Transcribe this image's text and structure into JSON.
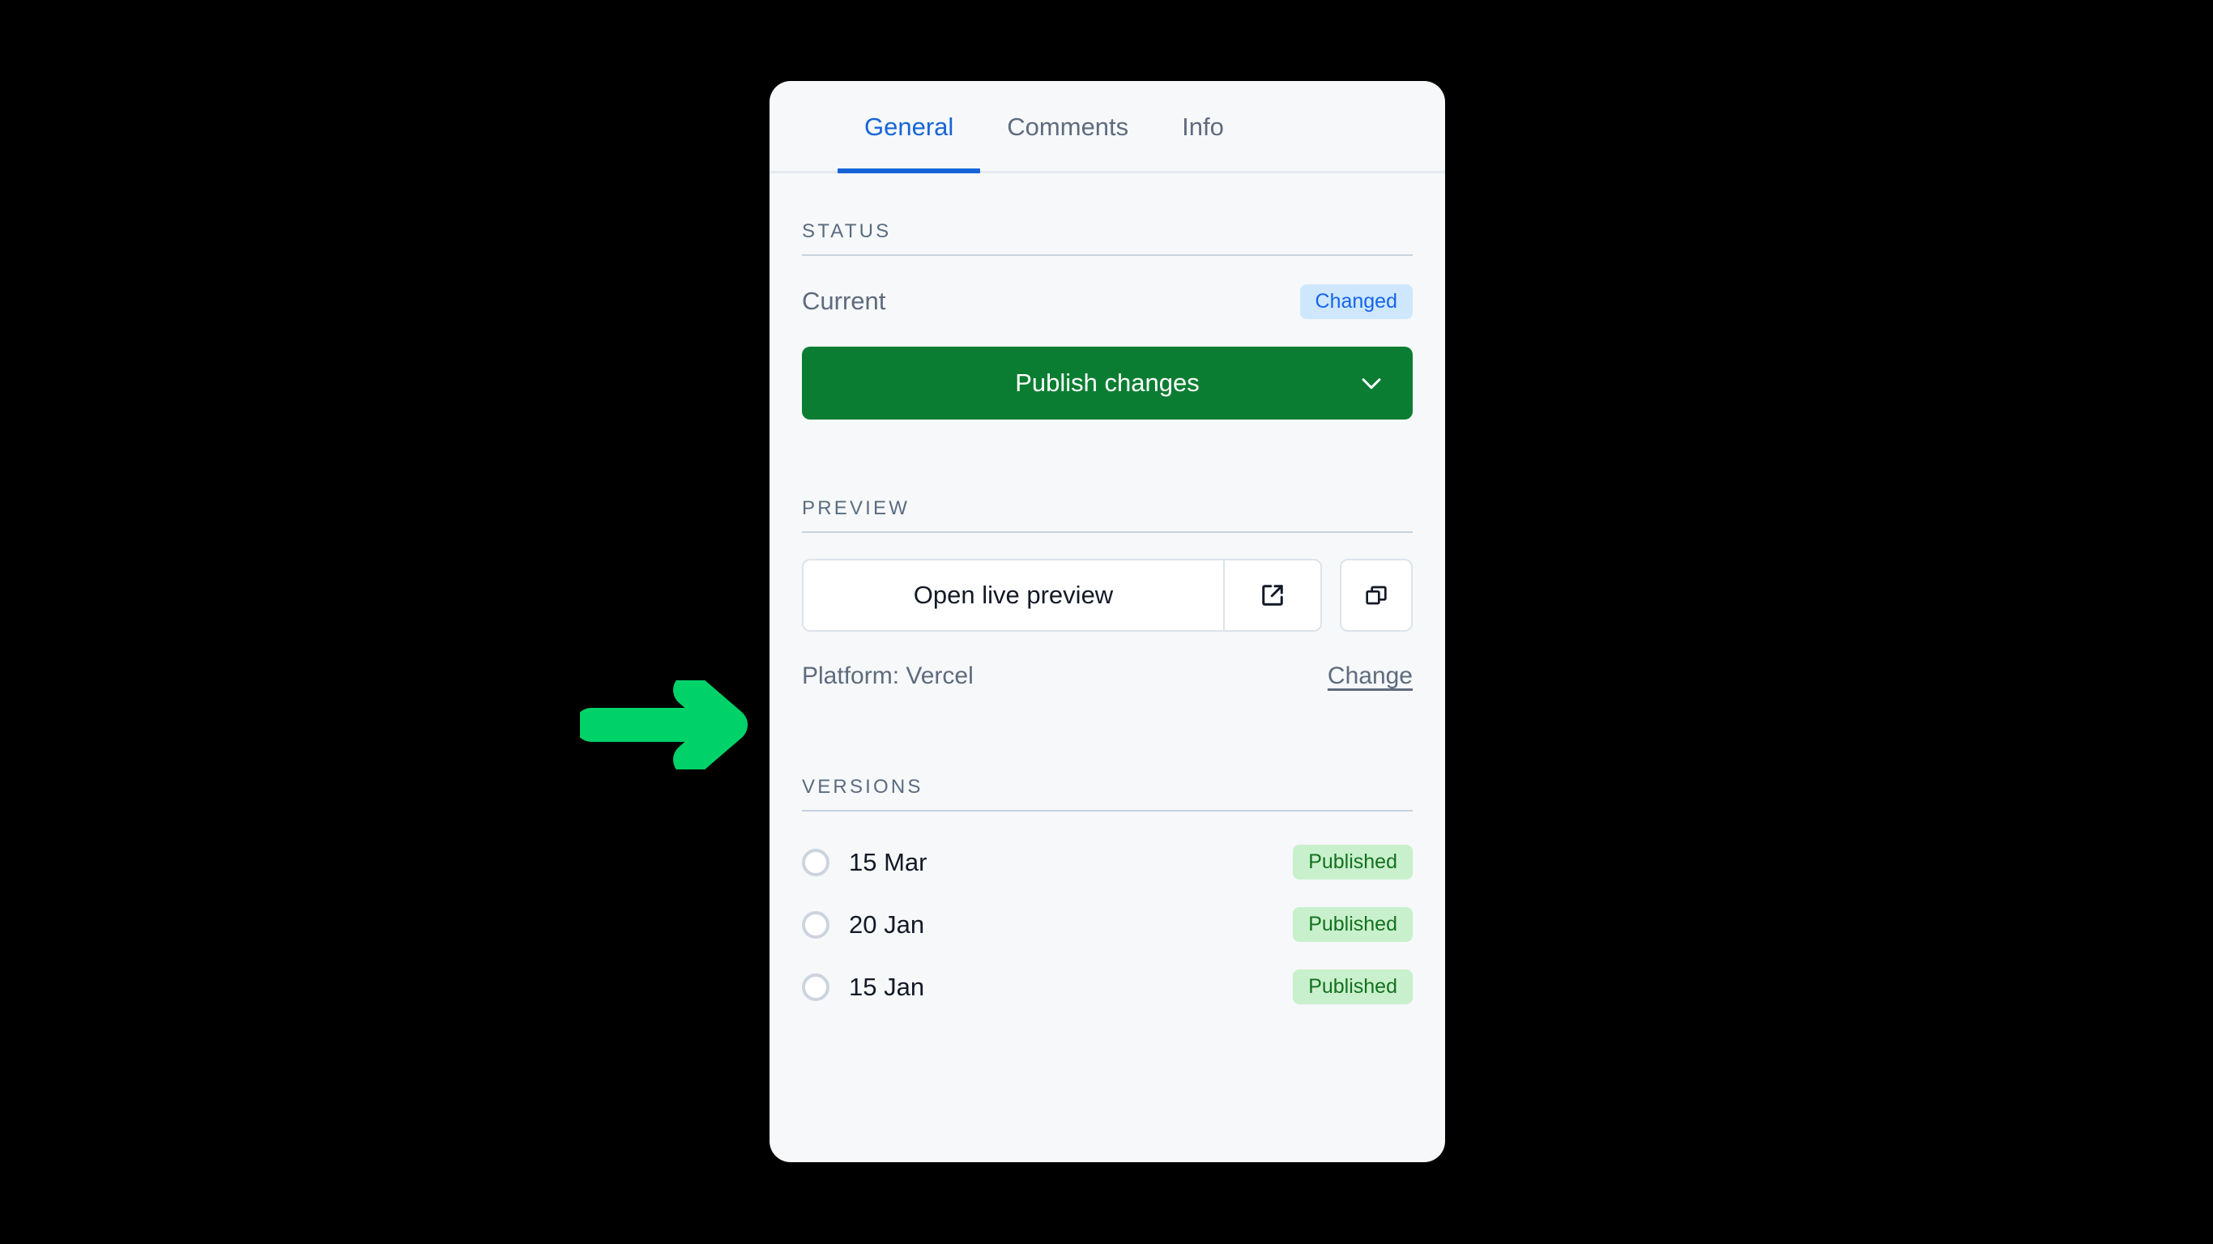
{
  "panel": {
    "tabs": [
      {
        "label": "General",
        "active": true
      },
      {
        "label": "Comments",
        "active": false
      },
      {
        "label": "Info",
        "active": false
      }
    ],
    "status": {
      "heading": "STATUS",
      "current_label": "Current",
      "current_badge": "Changed",
      "publish_button": "Publish changes",
      "publish_chevron_icon": "chevron-down-icon"
    },
    "preview": {
      "heading": "PREVIEW",
      "open_button": "Open live preview",
      "external_link_icon": "external-link-icon",
      "copy_icon": "copy-icon",
      "platform_label": "Platform: Vercel",
      "change_link": "Change"
    },
    "versions": {
      "heading": "VERSIONS",
      "items": [
        {
          "date": "15 Mar",
          "status": "Published"
        },
        {
          "date": "20 Jan",
          "status": "Published"
        },
        {
          "date": "15 Jan",
          "status": "Published"
        }
      ]
    }
  },
  "annotation": {
    "arrow_icon": "arrow-right-annotation",
    "arrow_color": "#00d26a",
    "points_at": "Platform: Vercel"
  },
  "colors": {
    "background": "#000000",
    "panel_background": "#f6f8fa",
    "accent_blue": "#1565d8",
    "publish_green": "#0b7d32",
    "badge_changed_bg": "#cfe7fc",
    "badge_changed_text": "#1565ea",
    "badge_published_bg": "#c9f0cc",
    "badge_published_text": "#13711f",
    "section_rule": "#c8d2dd",
    "muted_text": "#5f6b7d"
  }
}
